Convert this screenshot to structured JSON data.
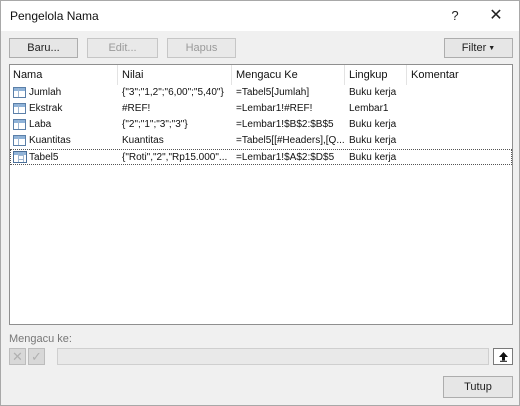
{
  "window": {
    "title": "Pengelola Nama",
    "help_label": "?",
    "close_label": "✕"
  },
  "toolbar": {
    "new_label": "Baru...",
    "edit_label": "Edit...",
    "delete_label": "Hapus",
    "filter_label": "Filter"
  },
  "columns": [
    "Nama",
    "Nilai",
    "Mengacu Ke",
    "Lingkup",
    "Komentar"
  ],
  "rows": [
    {
      "name": "Jumlah",
      "value": "{\"3\";\"1,2\";\"6,00\";\"5,40\"}",
      "refers_to": "=Tabel5[Jumlah]",
      "scope": "Buku kerja",
      "comment": "",
      "icon": "name-icon"
    },
    {
      "name": "Ekstrak",
      "value": "#REF!",
      "refers_to": "=Lembar1!#REF!",
      "scope": "Lembar1",
      "comment": "",
      "icon": "name-icon"
    },
    {
      "name": "Laba",
      "value": "{\"2\";\"1\";\"3\";\"3\"}",
      "refers_to": "=Lembar1!$B$2:$B$5",
      "scope": "Buku kerja",
      "comment": "",
      "icon": "name-icon"
    },
    {
      "name": "Kuantitas",
      "value": "Kuantitas",
      "refers_to": "=Tabel5[[#Headers],[Q...",
      "scope": "Buku kerja",
      "comment": "",
      "icon": "name-icon"
    },
    {
      "name": "Tabel5",
      "value": "{\"Roti\",\"2\",\"Rp15.000\"...",
      "refers_to": "=Lembar1!$A$2:$D$5",
      "scope": "Buku kerja",
      "comment": "",
      "icon": "table-icon"
    }
  ],
  "refers_to_label": "Mengacu ke:",
  "refers_to_value": "",
  "footer": {
    "close_label": "Tutup"
  }
}
